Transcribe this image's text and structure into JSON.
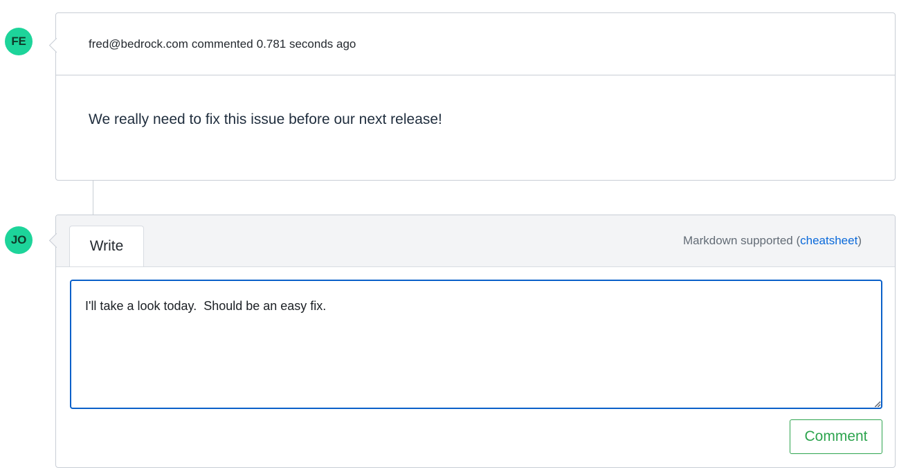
{
  "comment": {
    "avatar_initials": "FE",
    "author": "fred@bedrock.com",
    "action": "commented",
    "time_ago": "0.781 seconds ago",
    "body": "We really need to fix this issue before our next release!"
  },
  "composer": {
    "avatar_initials": "JO",
    "tab_write": "Write",
    "markdown_hint_prefix": "Markdown supported (",
    "markdown_hint_link": "cheatsheet",
    "markdown_hint_suffix": ")",
    "editor_value": "I'll take a look today.  Should be an easy fix.",
    "submit_label": "Comment"
  },
  "colors": {
    "avatar_bg": "#1dd49a",
    "accent_link": "#0969da",
    "editor_focus_border": "#0a60c9",
    "submit_green": "#2da44e"
  }
}
